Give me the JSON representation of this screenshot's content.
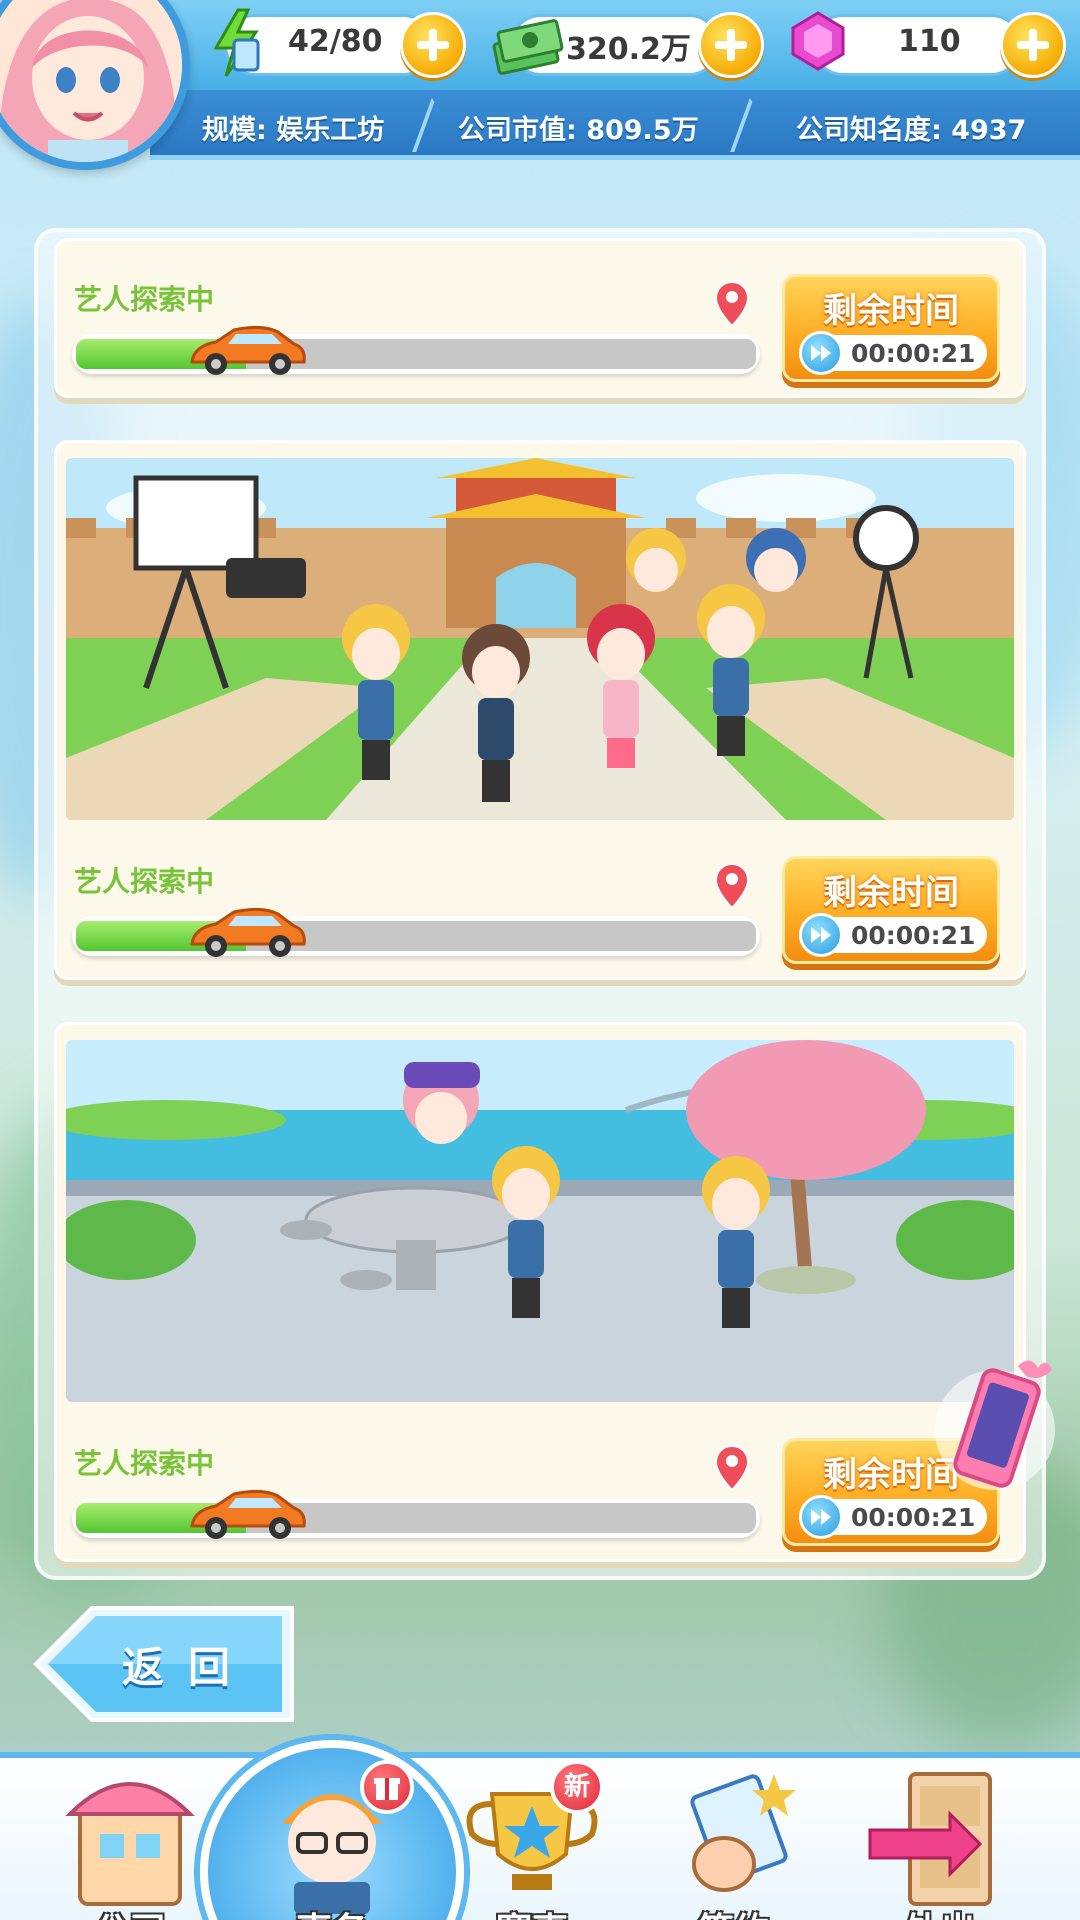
{
  "resources": {
    "energy": {
      "value": "42/80",
      "icon": "energy-hourglass-icon"
    },
    "money": {
      "value": "320.2万",
      "icon": "cash-stack-icon"
    },
    "gems": {
      "value": "110",
      "icon": "pink-gem-icon"
    }
  },
  "stats": {
    "scale": "规模: 娱乐工坊",
    "market_value": "公司市值: 809.5万",
    "fame": "公司知名度: 4937"
  },
  "cards": [
    {
      "status": "艺人探索中",
      "timer_title": "剩余时间",
      "timer_value": "00:00:21",
      "progress": 0.25,
      "scene": "none"
    },
    {
      "status": "艺人探索中",
      "timer_title": "剩余时间",
      "timer_value": "00:00:21",
      "progress": 0.25,
      "scene": "film-set-palace"
    },
    {
      "status": "艺人探索中",
      "timer_title": "剩余时间",
      "timer_value": "00:00:21",
      "progress": 0.25,
      "scene": "lakeside-park"
    }
  ],
  "back_button": {
    "label": "返回"
  },
  "nav": {
    "items": [
      {
        "label": "公司",
        "icon": "building-icon"
      },
      {
        "label": "事务",
        "icon": "manager-character-icon",
        "active": true,
        "badge": "gift-icon"
      },
      {
        "label": "赛事",
        "icon": "trophy-icon",
        "badge": "新"
      },
      {
        "label": "签约",
        "icon": "contract-icon"
      },
      {
        "label": "外出",
        "icon": "door-exit-icon"
      }
    ]
  },
  "colors": {
    "accent_blue": "#3e9bdd",
    "progress_green": "#53c632",
    "timer_orange": "#ffae25",
    "status_green": "#79c33a"
  }
}
